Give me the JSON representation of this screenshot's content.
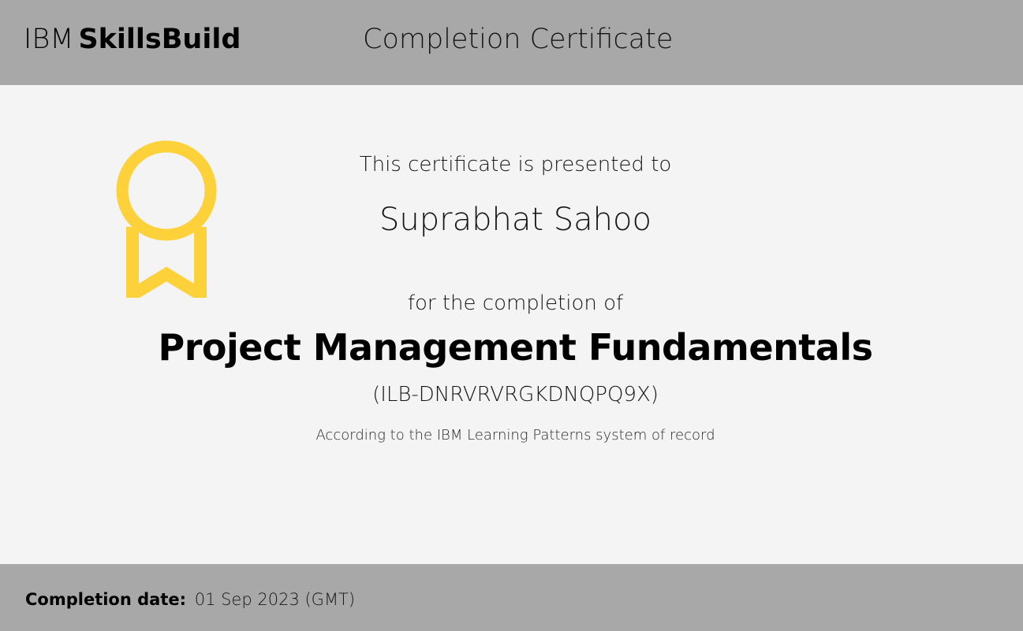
{
  "header": {
    "brand_prefix": "IBM",
    "brand_name": "SkillsBuild",
    "title": "Completion Certificate"
  },
  "certificate": {
    "presented_text": "This certificate is presented to",
    "recipient_name": "Suprabhat Sahoo",
    "completion_text": "for the completion of",
    "course_title": "Project Management Fundamentals",
    "course_id": "(ILB-DNRVRVRGKDNQPQ9X)",
    "record_text": "According to the IBM Learning Patterns system of record"
  },
  "footer": {
    "date_label": "Completion date:",
    "date_value": "01 Sep 2023 (GMT)"
  },
  "icons": {
    "award": "award-ribbon-icon"
  },
  "colors": {
    "header_bg": "#a8a8a8",
    "body_bg": "#f4f4f4",
    "ribbon": "#fdd13a"
  }
}
